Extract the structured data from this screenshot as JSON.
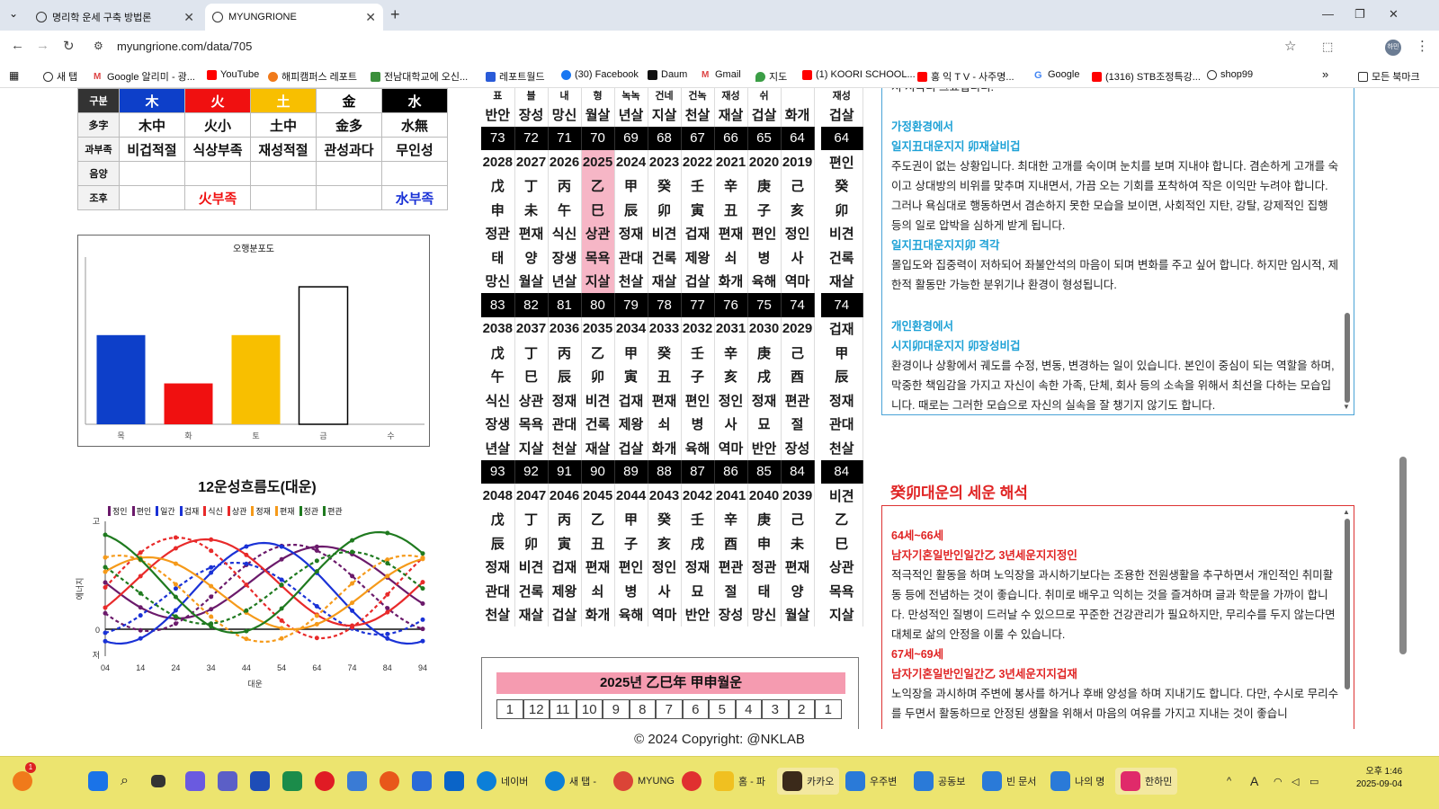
{
  "browser": {
    "tabs": [
      {
        "title": "명리학 운세 구축 방법론"
      },
      {
        "title": "MYUNGRIONE"
      }
    ],
    "url": "myungrione.com/data/705",
    "profile": "하민",
    "bookmarks": [
      "새 탭",
      "Google 알리미 - 광...",
      "YouTube",
      "해피캠퍼스 레포트",
      "전남대학교에 오신...",
      "레포트월드",
      "(30) Facebook",
      "Daum",
      "Gmail",
      "지도",
      "(1) KOORI SCHOOL...",
      "홍 익 T V - 사주명...",
      "Google",
      "(1316) STB조정특강...",
      "shop99"
    ],
    "bookmarks_more": "»",
    "all_bookmarks": "모든 북마크"
  },
  "elements_table": {
    "header_label": "구분",
    "elements": [
      {
        "name": "木",
        "color": "#0d3fc9"
      },
      {
        "name": "火",
        "color": "#f01010"
      },
      {
        "name": "土",
        "color": "#f8bf00"
      },
      {
        "name": "金",
        "color": "#ffffff"
      },
      {
        "name": "水",
        "color": "#000000"
      }
    ],
    "rows": [
      {
        "label": "多字",
        "cells": [
          "木中",
          "火小",
          "土中",
          "金多",
          "水無"
        ]
      },
      {
        "label": "과부족",
        "cells": [
          "비겁적절",
          "식상부족",
          "재성적절",
          "관성과다",
          "무인성"
        ]
      },
      {
        "label": "음양",
        "cells": [
          "",
          "",
          "",
          "",
          ""
        ]
      },
      {
        "label": "조후",
        "cells": [
          "",
          "火부족",
          "",
          "",
          "水부족"
        ]
      }
    ]
  },
  "bar_chart": {
    "chart_data": {
      "type": "bar",
      "title": "오행분포도",
      "categories": [
        "목",
        "화",
        "토",
        "금",
        "수"
      ],
      "values": [
        48,
        22,
        48,
        74,
        0
      ],
      "colors": [
        "#0d3fc9",
        "#f01010",
        "#f8bf00",
        "#ffffff",
        "#000000"
      ],
      "ylim": [
        0,
        90
      ]
    }
  },
  "flow_chart": {
    "title": "12운성흐름도(대운)",
    "legend": [
      {
        "name": "정인",
        "color": "#6b1a6b"
      },
      {
        "name": "편인",
        "color": "#6b1a6b"
      },
      {
        "name": "일간",
        "color": "#1a32d6"
      },
      {
        "name": "겁재",
        "color": "#1a32d6"
      },
      {
        "name": "식신",
        "color": "#e82a2a"
      },
      {
        "name": "상관",
        "color": "#e82a2a"
      },
      {
        "name": "정재",
        "color": "#f59a1a"
      },
      {
        "name": "편재",
        "color": "#f59a1a"
      },
      {
        "name": "정관",
        "color": "#1f7a1f"
      },
      {
        "name": "편관",
        "color": "#1f7a1f"
      }
    ],
    "ylabel": "에너지",
    "xlabel": "대운",
    "y_high": "고",
    "y_low": "저",
    "y_zero": "0",
    "x_ticks": [
      "04",
      "14",
      "24",
      "34",
      "44",
      "54",
      "64",
      "74",
      "84",
      "94"
    ]
  },
  "daewoon_grid": {
    "top_partial": {
      "ganji_row": [
        "표",
        "블",
        "내",
        "형",
        "녹녹",
        "건네",
        "건녹",
        "재성",
        "쉬"
      ],
      "shinsal": [
        "반안",
        "장성",
        "망신",
        "월살",
        "년살",
        "지살",
        "천살",
        "재살",
        "겁살",
        "화개"
      ],
      "side": [
        "재성",
        "겁살"
      ]
    },
    "blocks": [
      {
        "ages": [
          "73",
          "72",
          "71",
          "70",
          "69",
          "68",
          "67",
          "66",
          "65",
          "64"
        ],
        "side_age": "64",
        "years": [
          "2028",
          "2027",
          "2026",
          "2025",
          "2024",
          "2023",
          "2022",
          "2021",
          "2020",
          "2019"
        ],
        "stems": [
          "戊",
          "丁",
          "丙",
          "乙",
          "甲",
          "癸",
          "壬",
          "辛",
          "庚",
          "己"
        ],
        "branches": [
          "申",
          "未",
          "午",
          "巳",
          "辰",
          "卯",
          "寅",
          "丑",
          "子",
          "亥"
        ],
        "tengods": [
          "정관",
          "편재",
          "식신",
          "상관",
          "정재",
          "비견",
          "겁재",
          "편재",
          "편인",
          "정인"
        ],
        "stages": [
          "태",
          "양",
          "장생",
          "목욕",
          "관대",
          "건록",
          "제왕",
          "쇠",
          "병",
          "사"
        ],
        "shinsal": [
          "망신",
          "월살",
          "년살",
          "지살",
          "천살",
          "재살",
          "겁살",
          "화개",
          "육해",
          "역마"
        ],
        "side": [
          "편인",
          "癸",
          "卯",
          "비견",
          "건록",
          "재살"
        ],
        "highlight": 3
      },
      {
        "ages": [
          "83",
          "82",
          "81",
          "80",
          "79",
          "78",
          "77",
          "76",
          "75",
          "74"
        ],
        "side_age": "74",
        "years": [
          "2038",
          "2037",
          "2036",
          "2035",
          "2034",
          "2033",
          "2032",
          "2031",
          "2030",
          "2029"
        ],
        "stems": [
          "戊",
          "丁",
          "丙",
          "乙",
          "甲",
          "癸",
          "壬",
          "辛",
          "庚",
          "己"
        ],
        "branches": [
          "午",
          "巳",
          "辰",
          "卯",
          "寅",
          "丑",
          "子",
          "亥",
          "戌",
          "酉"
        ],
        "tengods": [
          "식신",
          "상관",
          "정재",
          "비견",
          "겁재",
          "편재",
          "편인",
          "정인",
          "정재",
          "편관"
        ],
        "stages": [
          "장생",
          "목욕",
          "관대",
          "건록",
          "제왕",
          "쇠",
          "병",
          "사",
          "묘",
          "절"
        ],
        "shinsal": [
          "년살",
          "지살",
          "천살",
          "재살",
          "겁살",
          "화개",
          "육해",
          "역마",
          "반안",
          "장성"
        ],
        "side": [
          "겁재",
          "甲",
          "辰",
          "정재",
          "관대",
          "천살"
        ],
        "highlight": -1
      },
      {
        "ages": [
          "93",
          "92",
          "91",
          "90",
          "89",
          "88",
          "87",
          "86",
          "85",
          "84"
        ],
        "side_age": "84",
        "years": [
          "2048",
          "2047",
          "2046",
          "2045",
          "2044",
          "2043",
          "2042",
          "2041",
          "2040",
          "2039"
        ],
        "stems": [
          "戊",
          "丁",
          "丙",
          "乙",
          "甲",
          "癸",
          "壬",
          "辛",
          "庚",
          "己"
        ],
        "branches": [
          "辰",
          "卯",
          "寅",
          "丑",
          "子",
          "亥",
          "戌",
          "酉",
          "申",
          "未"
        ],
        "tengods": [
          "정재",
          "비견",
          "겁재",
          "편재",
          "편인",
          "정인",
          "정재",
          "편관",
          "정관",
          "편재"
        ],
        "stages": [
          "관대",
          "건록",
          "제왕",
          "쇠",
          "병",
          "사",
          "묘",
          "절",
          "태",
          "양"
        ],
        "shinsal": [
          "천살",
          "재살",
          "겁살",
          "화개",
          "육해",
          "역마",
          "반안",
          "장성",
          "망신",
          "월살"
        ],
        "side": [
          "비견",
          "乙",
          "巳",
          "상관",
          "목욕",
          "지살"
        ],
        "highlight": -1
      }
    ]
  },
  "monthly": {
    "title": "2025년 乙巳年 甲申월운",
    "months": [
      "1",
      "12",
      "11",
      "10",
      "9",
      "8",
      "7",
      "6",
      "5",
      "4",
      "3",
      "2",
      "1"
    ]
  },
  "panel1": {
    "partial_top": "서 시극니 크뇨딥니니.",
    "s1_title": "가정환경에서",
    "s1_sub": "일지丑대운지지 卯재살비겁",
    "s1_text": "주도권이 없는 상황입니다. 최대한 고개를 숙이며 눈치를 보며 지내야 합니다. 겸손하게 고개를 숙이고 상대방의 비위를 맞추며 지내면서, 가끔 오는 기회를 포착하여 작은 이익만 누려야 합니다. 그러나 욕심대로 행동하면서 겸손하지 못한 모습을 보이면, 사회적인 지탄, 강탈, 강제적인 집행 등의 일로 압박을 심하게 받게 됩니다.",
    "s1_sub2": "일지丑대운지지卯 격각",
    "s1_text2": "몰입도와 집중력이 저하되어 좌불안석의 마음이 되며 변화를 주고 싶어 합니다. 하지만 임시적, 제한적 활동만 가능한 분위기나 환경이 형성됩니다.",
    "s2_title": "개인환경에서",
    "s2_sub": "시지卯대운지지 卯장성비겁",
    "s2_text": "환경이나 상황에서 궤도를 수정, 변동, 변경하는 일이 있습니다. 본인이 중심이 되는 역할을 하며, 막중한 책임감을 가지고 자신이 속한 가족, 단체, 회사 등의 소속을 위해서 최선을 다하는 모습입니다. 때로는 그러한 모습으로 자신의 실속을 잘 챙기지 않기도 합니다."
  },
  "section2": {
    "title": "癸卯대운의 세운 해석",
    "a1": "64세~66세",
    "a1_sub": "남자기혼일반인일간乙 3년세운지지정인",
    "a1_text": "적극적인 활동을 하며 노익장을 과시하기보다는 조용한 전원생활을 추구하면서 개인적인 취미활동 등에 전념하는 것이 좋습니다. 취미로 배우고 익히는 것을 즐겨하며 글과 학문을 가까이 합니다. 만성적인 질병이 드러날 수 있으므로 꾸준한 건강관리가 필요하지만, 무리수를 두지 않는다면 대체로 삶의 안정을 이룰 수 있습니다.",
    "a2": "67세~69세",
    "a2_sub": "남자기혼일반인일간乙 3년세운지지겁재",
    "a2_text": "노익장을 과시하며 주변에 봉사를 하거나 후배 양성을 하며 지내기도 합니다. 다만, 수시로 무리수를 두면서 활동하므로 안정된 생활을 위해서 마음의 여유를 가지고 지내는 것이 좋습니"
  },
  "footer": "© 2024 Copyright: @NKLAB",
  "taskbar": {
    "badge": "1",
    "apps": [
      "네이버",
      "새 탭 -",
      "MYUNG",
      "홈 - 파",
      "카카오",
      "우주변",
      "공동보",
      "빈 문서",
      "나의 명",
      "한하민"
    ],
    "time": "오후 1:46",
    "date": "2025-09-04",
    "ime": "A"
  }
}
